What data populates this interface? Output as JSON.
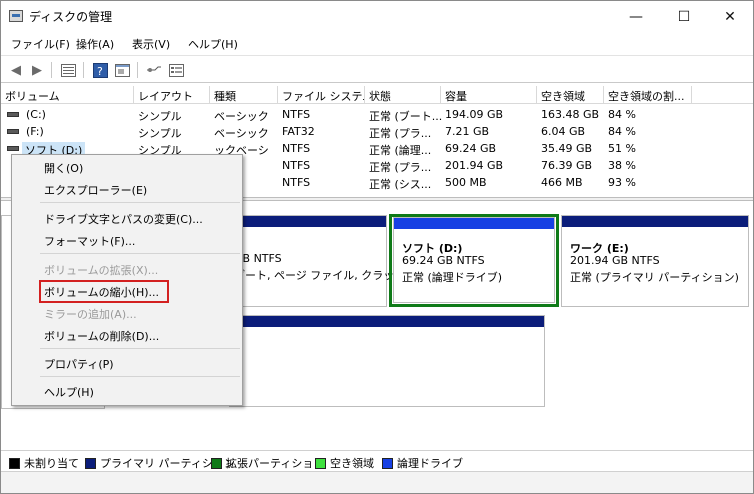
{
  "window": {
    "title": "ディスクの管理",
    "minimize_glyph": "—",
    "maximize_glyph": "☐",
    "close_glyph": "✕"
  },
  "menu": [
    "ファイル(F)",
    "操作(A)",
    "表示(V)",
    "ヘルプ(H)"
  ],
  "toolbar_icons": [
    "back-arrow-icon",
    "forward-arrow-icon",
    "list-view-icon",
    "help-icon",
    "console-icon",
    "connect-icon",
    "properties-icon"
  ],
  "columns": [
    "ボリューム",
    "レイアウト",
    "種類",
    "ファイル システム",
    "状態",
    "容量",
    "空き領域",
    "空き領域の割..."
  ],
  "rows": [
    {
      "volume": "(C:)",
      "layout": "シンプル",
      "type": "ベーシック",
      "fs": "NTFS",
      "status": "正常 (ブート...",
      "capacity": "194.09 GB",
      "free": "163.48 GB",
      "pct": "84 %"
    },
    {
      "volume": "(F:)",
      "layout": "シンプル",
      "type": "ベーシック",
      "fs": "FAT32",
      "status": "正常 (プラ...",
      "capacity": "7.21 GB",
      "free": "6.04 GB",
      "pct": "84 %"
    },
    {
      "volume": "ソフト (D:)",
      "layout": "シンプル",
      "type": "ックベーシ",
      "fs": "NTFS",
      "status": "正常 (論理...",
      "capacity": "69.24 GB",
      "free": "35.49 GB",
      "pct": "51 %"
    },
    {
      "volume": "",
      "layout": "",
      "type": "ック",
      "fs": "NTFS",
      "status": "正常 (プラ...",
      "capacity": "201.94 GB",
      "free": "76.39 GB",
      "pct": "38 %"
    },
    {
      "volume": "",
      "layout": "",
      "type": "ック",
      "fs": "NTFS",
      "status": "正常 (シス...",
      "capacity": "500 MB",
      "free": "466 MB",
      "pct": "93 %"
    }
  ],
  "volumes": {
    "c_partial": {
      "size": "GB NTFS",
      "status": "ブート, ページ ファイル, クラッシ:"
    },
    "d": {
      "name": "ソフト (D:)",
      "size": "69.24 GB NTFS",
      "status": "正常 (論理ドライブ)"
    },
    "e": {
      "name": "ワーク (E:)",
      "size": "201.94 GB NTFS",
      "status": "正常 (プライマリ パーティション)"
    },
    "f_partial": {
      "status": ")"
    }
  },
  "context_menu": {
    "items": [
      {
        "label": "開く(O)",
        "enabled": true
      },
      {
        "label": "エクスプローラー(E)",
        "enabled": true
      },
      {
        "label": "ドライブ文字とパスの変更(C)...",
        "enabled": true
      },
      {
        "label": "フォーマット(F)...",
        "enabled": true
      },
      {
        "label": "ボリュームの拡張(X)...",
        "enabled": false
      },
      {
        "label": "ボリュームの縮小(H)...",
        "enabled": true,
        "highlighted": true
      },
      {
        "label": "ミラーの追加(A)...",
        "enabled": false
      },
      {
        "label": "ボリュームの削除(D)...",
        "enabled": true
      },
      {
        "label": "プロパティ(P)",
        "enabled": true
      },
      {
        "label": "ヘルプ(H)",
        "enabled": true
      }
    ]
  },
  "legend": [
    {
      "label": "未割り当て",
      "color": "#000000"
    },
    {
      "label": "プライマリ パーティション",
      "color": "#0b1d7a"
    },
    {
      "label": "拡張パーティション",
      "color": "#0f7a18"
    },
    {
      "label": "空き領域",
      "color": "#3fe13f"
    },
    {
      "label": "論理ドライブ",
      "color": "#1740e3"
    }
  ]
}
